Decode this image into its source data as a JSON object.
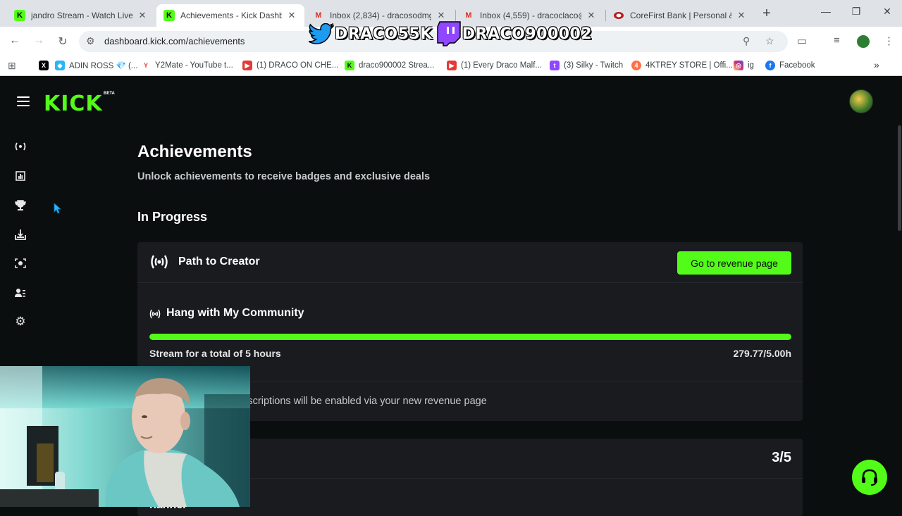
{
  "browser": {
    "tabs": [
      {
        "title": "jandro Stream - Watch Live o",
        "favicon": "kick-favicon",
        "active": false
      },
      {
        "title": "Achievements - Kick Dashbo",
        "favicon": "kick-favicon",
        "active": true
      },
      {
        "title": "Inbox (2,834) - dracosodmg9",
        "favicon": "gmail-favicon",
        "active": false
      },
      {
        "title": "Inbox (4,559) - dracoclaco@",
        "favicon": "gmail-favicon",
        "active": false
      },
      {
        "title": "CoreFirst Bank | Personal & B",
        "favicon": "bank-favicon",
        "active": false
      }
    ],
    "url": "dashboard.kick.com/achievements",
    "bookmarks": [
      {
        "label": "",
        "icon": "x-icon"
      },
      {
        "label": "ADIN ROSS 💎 (...",
        "icon": "diamond-icon"
      },
      {
        "label": "Y2Mate - YouTube t...",
        "icon": "y2mate-icon"
      },
      {
        "label": "(1) DRACO ON CHE...",
        "icon": "youtube-icon"
      },
      {
        "label": "draco900002 Strea...",
        "icon": "kick-icon"
      },
      {
        "label": "(1) Every Draco Malf...",
        "icon": "youtube-icon"
      },
      {
        "label": "(3) Silky - Twitch",
        "icon": "twitch-icon"
      },
      {
        "label": "4KTREY STORE | Offi...",
        "icon": "store-icon"
      },
      {
        "label": "ig",
        "icon": "instagram-icon"
      },
      {
        "label": "Facebook",
        "icon": "facebook-icon"
      }
    ]
  },
  "overlay": {
    "twitter_handle": "DRACO55K",
    "twitch_handle": "DRACO900002"
  },
  "app": {
    "logo": "KICK",
    "logo_badge": "BETA",
    "sidebar_icons": [
      "live-icon",
      "analytics-icon",
      "trophy-icon",
      "upload-icon",
      "camera-icon",
      "community-icon",
      "settings-icon"
    ]
  },
  "page": {
    "title": "Achievements",
    "subtitle": "Unlock achievements to receive badges and exclusive deals",
    "section": "In Progress",
    "card1": {
      "title": "Path to Creator",
      "button": "Go to revenue page",
      "task_title": "Hang with My Community",
      "task_desc": "Stream for a total of 5 hours",
      "task_value": "279.77/5.00h",
      "progress_fraction": 1.0,
      "note": "eator status, your subscriptions will be enabled via your new revenue page"
    },
    "card2": {
      "title": "ication",
      "count": "3/5",
      "sub": "hannel"
    }
  },
  "colors": {
    "accent": "#53fc18",
    "background": "#0b0e0f",
    "card": "#191b1f"
  }
}
